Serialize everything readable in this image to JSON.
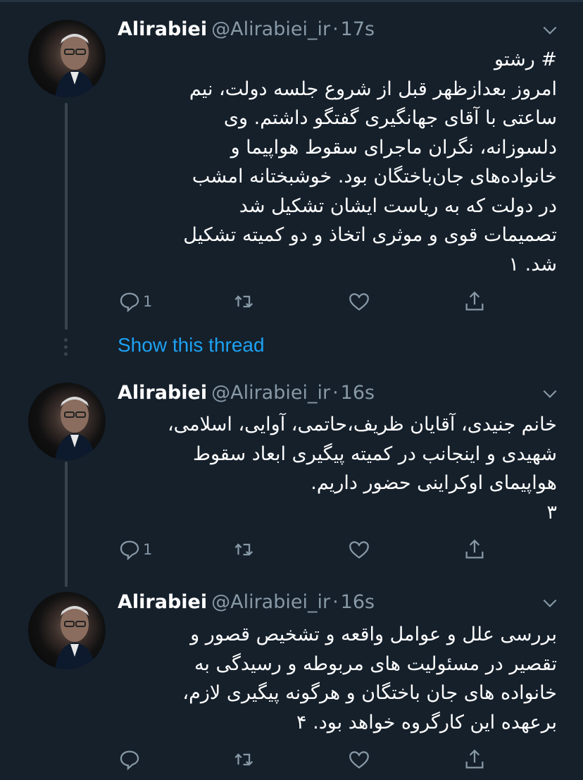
{
  "tweets": [
    {
      "author_name": "Alirabiei",
      "handle": "@Alirabiei_ir",
      "separator": "·",
      "time": "17s",
      "text": "# رشتو\nامروز بعدازظهر قبل از شروع جلسه دولت، نیم\nساعتی با آقای جهانگیری گفتگو داشتم. وی\nدلسوزانه، نگران ماجرای سقوط هواپیما و\nخانواده‌های جان‌باختگان بود. خوشبختانه امشب\nدر دولت که به ریاست ایشان تشکیل شد\nتصمیمات قوی و موثری اتخاذ و دو کمیته تشکیل\nشد. ۱",
      "reply_count": "1"
    },
    {
      "author_name": "Alirabiei",
      "handle": "@Alirabiei_ir",
      "separator": "·",
      "time": "16s",
      "text": "خانم جنیدی، آقایان ظریف،حاتمی، آوایی، اسلامی،\nشهیدی و اینجانب در کمیته پیگیری ابعاد سقوط\nهواپیمای اوکراینی حضور داریم.\n۳",
      "reply_count": "1"
    },
    {
      "author_name": "Alirabiei",
      "handle": "@Alirabiei_ir",
      "separator": "·",
      "time": "16s",
      "text": "بررسی علل و عوامل واقعه و تشخیص قصور و\nتقصیر در مسئولیت های مربوطه و رسیدگی به\nخانواده های جان باختگان و هرگونه پیگیری لازم،\nبرعهده این کارگروه خواهد بود. ۴",
      "reply_count": ""
    }
  ],
  "show_thread_label": "Show this thread",
  "icons": {
    "reply": "reply-icon",
    "retweet": "retweet-icon",
    "like": "like-icon",
    "share": "share-icon",
    "menu": "chevron-down-icon"
  },
  "colors": {
    "background": "#15202b",
    "secondary_text": "#8899a6",
    "link": "#1da1f2",
    "thread_line": "#38444d"
  }
}
